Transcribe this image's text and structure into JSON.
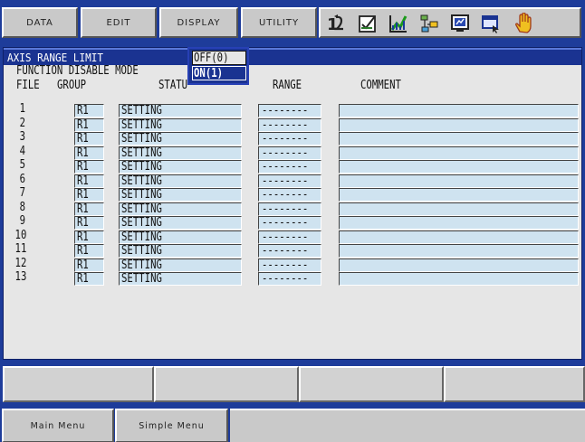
{
  "menu": {
    "data": "DATA",
    "edit": "EDIT",
    "display": "DISPLAY",
    "utility": "UTILITY"
  },
  "toolbar_icons": [
    "robot-axes-icon",
    "edit-checkbox-icon",
    "chart-icon",
    "network-icon",
    "monitor-icon",
    "window-icon",
    "hand-icon"
  ],
  "screen": {
    "title": "AXIS RANGE LIMIT",
    "mode_label": "FUNCTION DISABLE MODE",
    "headers": {
      "file": "FILE",
      "group": "GROUP",
      "status": "STATU",
      "range": "RANGE",
      "comment": "COMMENT"
    },
    "rows": [
      {
        "file": "1",
        "group": "R1",
        "status": "SETTING",
        "range": "--------",
        "comment": ""
      },
      {
        "file": "2",
        "group": "R1",
        "status": "SETTING",
        "range": "--------",
        "comment": ""
      },
      {
        "file": "3",
        "group": "R1",
        "status": "SETTING",
        "range": "--------",
        "comment": ""
      },
      {
        "file": "4",
        "group": "R1",
        "status": "SETTING",
        "range": "--------",
        "comment": ""
      },
      {
        "file": "5",
        "group": "R1",
        "status": "SETTING",
        "range": "--------",
        "comment": ""
      },
      {
        "file": "6",
        "group": "R1",
        "status": "SETTING",
        "range": "--------",
        "comment": ""
      },
      {
        "file": "7",
        "group": "R1",
        "status": "SETTING",
        "range": "--------",
        "comment": ""
      },
      {
        "file": "8",
        "group": "R1",
        "status": "SETTING",
        "range": "--------",
        "comment": ""
      },
      {
        "file": "9",
        "group": "R1",
        "status": "SETTING",
        "range": "--------",
        "comment": ""
      },
      {
        "file": "10",
        "group": "R1",
        "status": "SETTING",
        "range": "--------",
        "comment": ""
      },
      {
        "file": "11",
        "group": "R1",
        "status": "SETTING",
        "range": "--------",
        "comment": ""
      },
      {
        "file": "12",
        "group": "R1",
        "status": "SETTING",
        "range": "--------",
        "comment": ""
      },
      {
        "file": "13",
        "group": "R1",
        "status": "SETTING",
        "range": "--------",
        "comment": ""
      }
    ]
  },
  "popup": {
    "options": [
      "OFF(0)",
      "ON(1)"
    ],
    "selected": "ON(1)"
  },
  "bottom": {
    "main_menu": "Main Menu",
    "simple_menu": "Simple Menu"
  },
  "colors": {
    "frame_blue": "#1e3c9a",
    "title_blue": "#1a3391",
    "cell_blue": "#cfe3f0",
    "panel_gray": "#e6e6e6"
  }
}
